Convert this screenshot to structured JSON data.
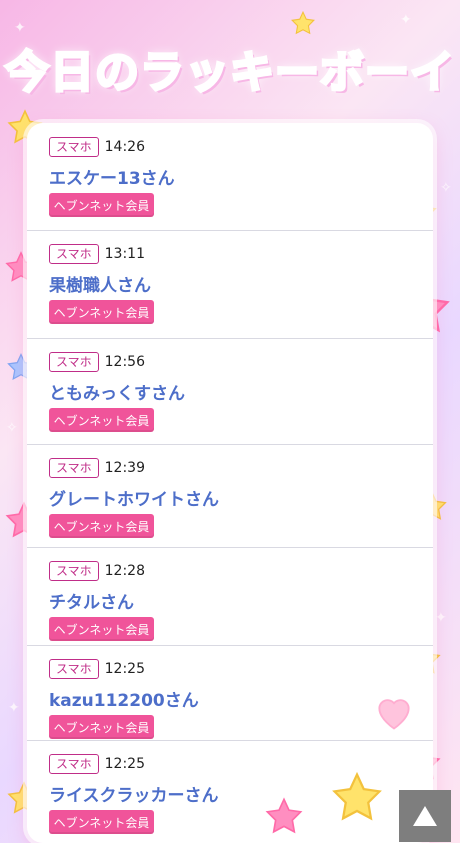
{
  "page": {
    "title": "今日のラッキーボーイ"
  },
  "entries": [
    {
      "device": "スマホ",
      "time": "14:26",
      "name": "エスケー13さん",
      "member": "ヘブンネット会員"
    },
    {
      "device": "スマホ",
      "time": "13:11",
      "name": "果樹職人さん",
      "member": "ヘブンネット会員"
    },
    {
      "device": "スマホ",
      "time": "12:56",
      "name": "ともみっくすさん",
      "member": "ヘブンネット会員"
    },
    {
      "device": "スマホ",
      "time": "12:39",
      "name": "グレートホワイトさん",
      "member": "ヘブンネット会員"
    },
    {
      "device": "スマホ",
      "time": "12:28",
      "name": "チタルさん",
      "member": "ヘブンネット会員"
    },
    {
      "device": "スマホ",
      "time": "12:25",
      "name": "kazu112200さん",
      "member": "ヘブンネット会員"
    },
    {
      "device": "スマホ",
      "time": "12:25",
      "name": "ライスクラッカーさん",
      "member": "ヘブンネット会員"
    }
  ],
  "icons": {
    "scroll_top": "up-triangle-icon",
    "decor": [
      "star-icon",
      "heart-icon"
    ]
  },
  "colors": {
    "accent": "#f0549a",
    "name": "#4d6ec9",
    "badge": "#c02d88"
  }
}
